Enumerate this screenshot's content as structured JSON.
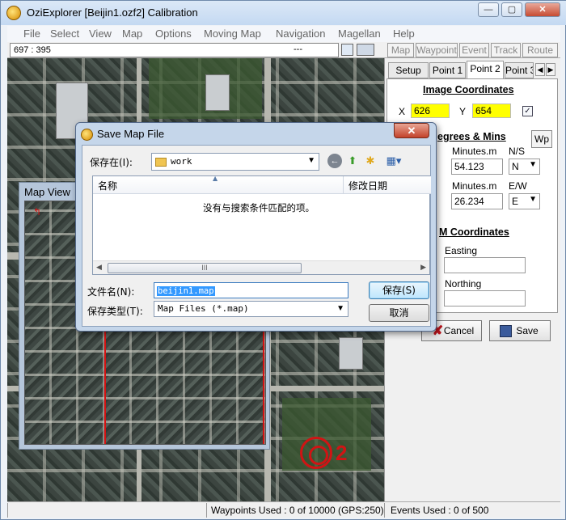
{
  "window": {
    "title": "OziExplorer [Beijin1.ozf2] Calibration"
  },
  "menu": [
    "File",
    "Select",
    "View",
    "Map",
    "Options",
    "Moving Map",
    "Navigation",
    "Magellan",
    "Help"
  ],
  "toolbar": {
    "coord": "697 : 395",
    "dots": "---",
    "tabs": [
      "Map",
      "Waypoint",
      "Event",
      "Track",
      "Route"
    ]
  },
  "map": {
    "marker_label": "2"
  },
  "mapview": {
    "title": "Map View"
  },
  "calib": {
    "tabs": [
      "Setup",
      "Point 1",
      "Point 2",
      "Point 3"
    ],
    "image_coords_title": "Image Coordinates",
    "x_label": "X",
    "x_value": "626",
    "y_label": "Y",
    "y_value": "654",
    "degrees_title": "egrees & Mins",
    "wp_label": "Wp",
    "minutes_label": "Minutes.m",
    "ns_label": "N/S",
    "lat_minutes": "54.123",
    "ns_value": "N",
    "ew_label": "E/W",
    "lon_minutes": "26.234",
    "ew_value": "E",
    "utm_title": "M Coordinates",
    "easting_label": "Easting",
    "northing_label": "Northing",
    "cancel_label": "Cancel",
    "save_label": "Save"
  },
  "status": {
    "waypoints": "Waypoints Used : 0 of 10000  (GPS:250)",
    "events": "Events Used : 0 of 500"
  },
  "dialog": {
    "title": "Save Map File",
    "save_in_label": "保存在(I):",
    "folder": "work",
    "col_name": "名称",
    "col_date": "修改日期",
    "empty_msg": "没有与搜索条件匹配的项。",
    "filename_label": "文件名(N):",
    "filename_value": "beijin1.map",
    "filetype_label": "保存类型(T):",
    "filetype_value": "Map Files (*.map)",
    "save_button": "保存(S)",
    "cancel_button": "取消"
  }
}
